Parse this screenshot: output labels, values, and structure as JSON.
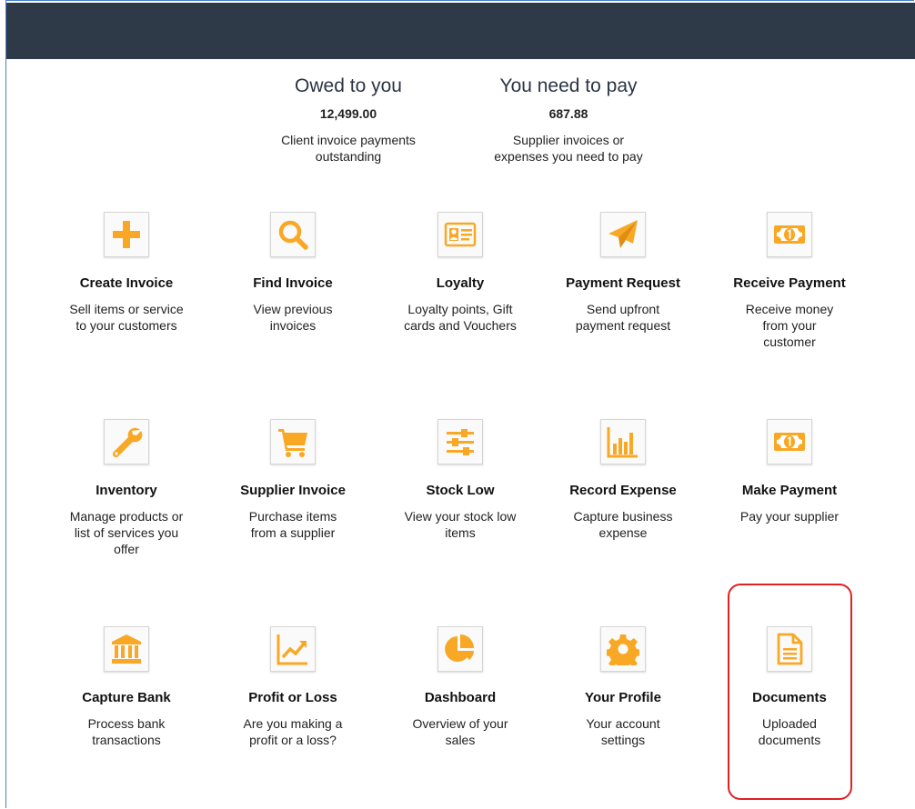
{
  "summary": {
    "owed": {
      "heading": "Owed to you",
      "amount": "12,499.00",
      "desc_line1": "Client invoice payments",
      "desc_line2": "outstanding"
    },
    "pay": {
      "heading": "You need to pay",
      "amount": "687.88",
      "desc_line1": "Supplier invoices or",
      "desc_line2": "expenses you need to pay"
    }
  },
  "accent_color": "#f9a825",
  "highlight_color": "#dd2222",
  "tiles": [
    {
      "icon": "plus-icon",
      "title": "Create Invoice",
      "desc": [
        "Sell items or service",
        "to your customers"
      ]
    },
    {
      "icon": "search-icon",
      "title": "Find Invoice",
      "desc": [
        "View previous",
        "invoices"
      ]
    },
    {
      "icon": "id-card-icon",
      "title": "Loyalty",
      "desc": [
        "Loyalty points, Gift",
        "cards and Vouchers"
      ]
    },
    {
      "icon": "paper-plane-icon",
      "title": "Payment Request",
      "desc": [
        "Send upfront",
        "payment request"
      ]
    },
    {
      "icon": "money-bill-icon",
      "title": "Receive Payment",
      "desc": [
        "Receive money",
        "from your",
        "customer"
      ]
    },
    {
      "icon": "wrench-icon",
      "title": "Inventory",
      "desc": [
        "Manage products or",
        "list of services you",
        "offer"
      ]
    },
    {
      "icon": "shopping-cart-icon",
      "title": "Supplier Invoice",
      "desc": [
        "Purchase items",
        "from a supplier"
      ]
    },
    {
      "icon": "sliders-icon",
      "title": "Stock Low",
      "desc": [
        "View your stock low",
        "items"
      ]
    },
    {
      "icon": "bar-chart-icon",
      "title": "Record Expense",
      "desc": [
        "Capture business",
        "expense"
      ]
    },
    {
      "icon": "money-bill-icon",
      "title": "Make Payment",
      "desc": [
        "Pay your supplier"
      ]
    },
    {
      "icon": "bank-icon",
      "title": "Capture Bank",
      "desc": [
        "Process bank",
        "transactions"
      ]
    },
    {
      "icon": "line-chart-icon",
      "title": "Profit or Loss",
      "desc": [
        "Are you making a",
        "profit or a loss?"
      ]
    },
    {
      "icon": "pie-chart-icon",
      "title": "Dashboard",
      "desc": [
        "Overview of your",
        "sales"
      ]
    },
    {
      "icon": "gear-icon",
      "title": "Your Profile",
      "desc": [
        "Your account",
        "settings"
      ]
    },
    {
      "icon": "document-icon",
      "title": "Documents",
      "desc": [
        "Uploaded",
        "documents"
      ]
    }
  ]
}
